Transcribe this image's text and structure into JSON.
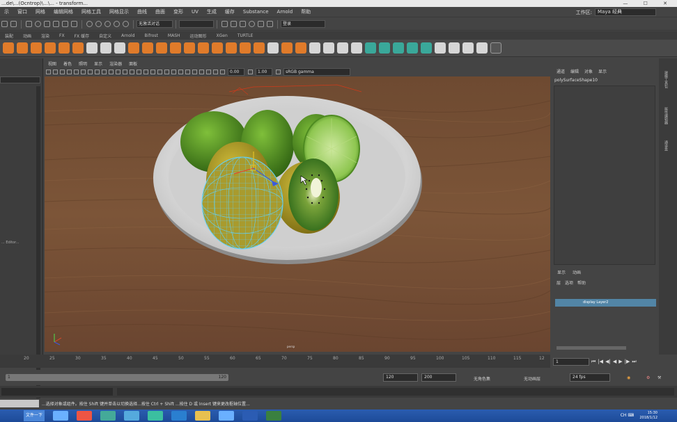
{
  "window": {
    "title": "...de\\...(Ocntrop)\\...\\... - transform..."
  },
  "menubar": {
    "items": [
      "示",
      "窗口",
      "网格",
      "编辑网格",
      "网格工具",
      "网格显示",
      "曲线",
      "曲面",
      "变形",
      "UV",
      "生成",
      "缓存",
      "Substance",
      "Arnold",
      "帮助"
    ],
    "workspace_label": "工作区:",
    "workspace_value": "Maya 经典"
  },
  "statusline": {
    "field1": "无激活对话",
    "field2": "",
    "login_label": "登录"
  },
  "shelf": {
    "tabs": [
      "装配",
      "动画",
      "渲染",
      "FX",
      "FX 缓存",
      "自定义",
      "Arnold",
      "Bifrost",
      "MASH",
      "运动图形",
      "XGen",
      "TURTLE"
    ]
  },
  "viewport": {
    "menus": [
      "视图",
      "着色",
      "照明",
      "显示",
      "渲染器",
      "面板"
    ],
    "field_a": "0.00",
    "field_b": "1.00",
    "colorspace": "sRGB gamma",
    "camera_label": "persp"
  },
  "channelbox": {
    "tabs": [
      "通道",
      "编辑",
      "对象",
      "显示"
    ],
    "node_name": "polySurfaceShape10"
  },
  "layers": {
    "tabs": [
      "显示",
      "动画"
    ],
    "menu": [
      "层",
      "选项",
      "帮助"
    ],
    "row_label": "display Layer2"
  },
  "sidetabs": [
    "建模工具包",
    "属性编辑器",
    "通道盒"
  ],
  "timeslider": {
    "ticks": [
      "20",
      "25",
      "30",
      "35",
      "40",
      "45",
      "50",
      "55",
      "60",
      "65",
      "70",
      "75",
      "80",
      "85",
      "90",
      "95",
      "100",
      "105",
      "110",
      "115",
      "12"
    ],
    "current_frame": "1"
  },
  "rangeslider": {
    "start_label": "1",
    "end_label": "120",
    "end_time": "120",
    "end_range": "200",
    "char_set_label": "无角色集",
    "anim_layer_label": "无动画层",
    "fps": "24 fps"
  },
  "helpline": {
    "text": "...选择对象或组件。按住 Shift 键并单击以切换选择...按住 Ctrl + Shift ...按住 D 或 Insert 键来更改枢轴位置..."
  },
  "taskbar": {
    "start_label": "文件一下",
    "tray_icons": "CH ⌨",
    "time": "15:30",
    "date": "2018/1/12"
  },
  "colors": {
    "accent": "#5285a6",
    "wood": "#7a5236",
    "lime": "#4f8a1c",
    "kiwi_flesh": "#3c7a1f",
    "kiwi_skin": "#a8941f"
  }
}
